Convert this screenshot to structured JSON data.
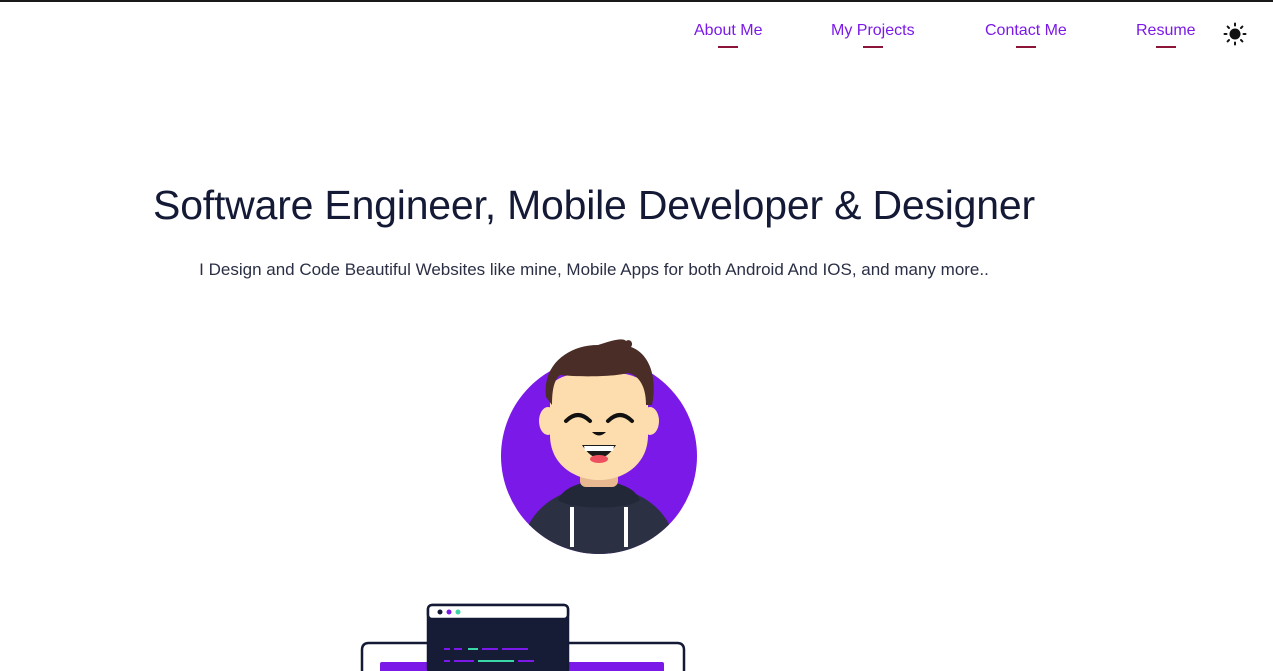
{
  "nav": {
    "items": [
      {
        "label": "About Me"
      },
      {
        "label": "My Projects"
      },
      {
        "label": "Contact Me"
      },
      {
        "label": "Resume"
      }
    ],
    "theme_icon": "sun-icon"
  },
  "hero": {
    "title": "Software Engineer, Mobile Developer & Designer",
    "subtitle": "I Design and Code Beautiful Websites like mine, Mobile Apps for both Android And IOS, and many more.."
  },
  "colors": {
    "accent": "#7b19e8",
    "underline": "#8a1538",
    "heading": "#141a36",
    "avatar_bg": "#7b19e8"
  },
  "icons": {
    "avatar": "developer-avatar-illustration",
    "illustration": "coding-laptop-illustration"
  }
}
